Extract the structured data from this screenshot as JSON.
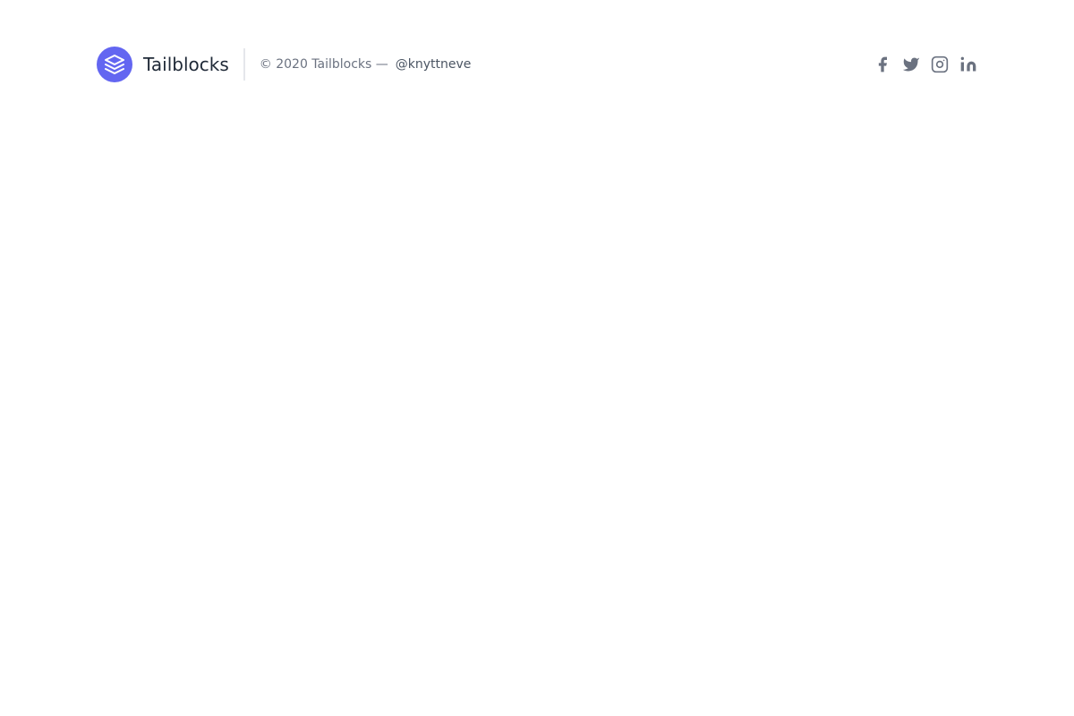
{
  "brand": {
    "name": "Tailblocks",
    "logo_icon": "layers-icon",
    "logo_color": "#6366f1"
  },
  "copyright": {
    "text": "© 2020 Tailblocks —",
    "handle": "@knyttneve"
  },
  "social": [
    {
      "icon": "facebook-icon"
    },
    {
      "icon": "twitter-icon"
    },
    {
      "icon": "instagram-icon"
    },
    {
      "icon": "linkedin-icon"
    }
  ],
  "colors": {
    "accent": "#6366f1",
    "text_muted": "#6b7280",
    "text_dark": "#1f2937"
  }
}
